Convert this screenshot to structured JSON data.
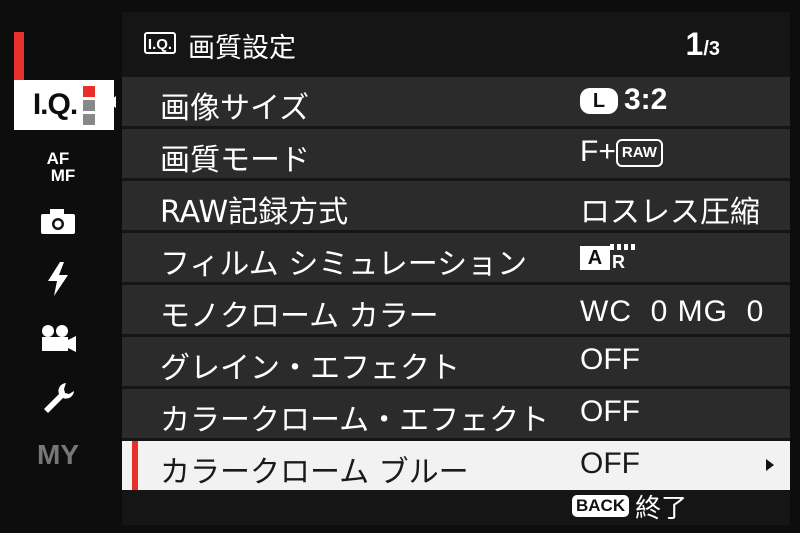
{
  "tabs": [
    {
      "id": "iq",
      "label": "I.Q."
    },
    {
      "id": "af",
      "label_top": "AF",
      "label_bottom": "MF"
    },
    {
      "id": "shooting",
      "icon": "camera-icon"
    },
    {
      "id": "flash",
      "icon": "lightning-icon"
    },
    {
      "id": "movie",
      "icon": "movie-camera-icon"
    },
    {
      "id": "setup",
      "icon": "wrench-icon"
    },
    {
      "id": "my",
      "label": "MY"
    }
  ],
  "header": {
    "badge": "I.Q.",
    "title": "画質設定",
    "page_current": "1",
    "page_total": "/3"
  },
  "rows": [
    {
      "label": "画像サイズ",
      "value_badge": "L",
      "value": "3:2"
    },
    {
      "label": "画質モード",
      "value": "F+",
      "value_badge": "RAW"
    },
    {
      "label": "RAW記録方式",
      "value": "ロスレス圧縮"
    },
    {
      "label": "フィルム シミュレーション",
      "value_badge": "A",
      "value_sub": "R"
    },
    {
      "label": "モノクローム カラー",
      "value": "WC  0 MG  0"
    },
    {
      "label": "グレイン・エフェクト",
      "value": "OFF"
    },
    {
      "label": "カラークローム・エフェクト",
      "value": "OFF"
    },
    {
      "label": "カラークローム ブルー",
      "value": "OFF"
    }
  ],
  "footer": {
    "button": "BACK",
    "label": "終了"
  },
  "colors": {
    "accent": "#e8302a",
    "selected_row": "#f2f2f2",
    "row": "#2b2b2b",
    "panel": "#151515"
  }
}
